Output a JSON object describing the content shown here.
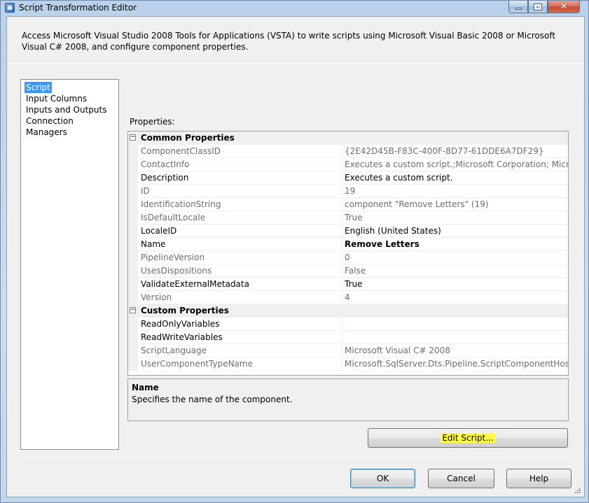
{
  "window": {
    "title": "Script Transformation Editor",
    "minimize_icon": "minimize-icon",
    "maximize_icon": "maximize-icon",
    "close_icon": "close-icon"
  },
  "description": "Access Microsoft Visual Studio 2008 Tools for Applications (VSTA) to write scripts using Microsoft Visual Basic 2008 or Microsoft Visual C# 2008, and configure component properties.",
  "nav": {
    "items": [
      {
        "label": "Script",
        "selected": true
      },
      {
        "label": "Input Columns",
        "selected": false
      },
      {
        "label": "Inputs and Outputs",
        "selected": false
      },
      {
        "label": "Connection Managers",
        "selected": false
      }
    ]
  },
  "properties": {
    "label": "Properties:",
    "common": {
      "label": "Common Properties",
      "toggle": "⊟",
      "rows": [
        {
          "name": "ComponentClassID",
          "value": "{2E42D45B-F83C-400F-8D77-61DDE6A7DF29}",
          "readonly": true
        },
        {
          "name": "ContactInfo",
          "value": "Executes a custom script.;Microsoft Corporation; Microsoft S",
          "readonly": true
        },
        {
          "name": "Description",
          "value": "Executes a custom script.",
          "readonly": false
        },
        {
          "name": "ID",
          "value": "19",
          "readonly": true
        },
        {
          "name": "IdentificationString",
          "value": "component \"Remove Letters\" (19)",
          "readonly": true
        },
        {
          "name": "IsDefaultLocale",
          "value": "True",
          "readonly": true
        },
        {
          "name": "LocaleID",
          "value": "English (United States)",
          "readonly": false
        },
        {
          "name": "Name",
          "value": "Remove Letters",
          "readonly": false,
          "bold": true
        },
        {
          "name": "PipelineVersion",
          "value": "0",
          "readonly": true
        },
        {
          "name": "UsesDispositions",
          "value": "False",
          "readonly": true
        },
        {
          "name": "ValidateExternalMetadata",
          "value": "True",
          "readonly": false
        },
        {
          "name": "Version",
          "value": "4",
          "readonly": true
        }
      ]
    },
    "custom": {
      "label": "Custom Properties",
      "toggle": "⊟",
      "rows": [
        {
          "name": "ReadOnlyVariables",
          "value": "",
          "readonly": false
        },
        {
          "name": "ReadWriteVariables",
          "value": "",
          "readonly": false
        },
        {
          "name": "ScriptLanguage",
          "value": "Microsoft Visual C# 2008",
          "readonly": true
        },
        {
          "name": "UserComponentTypeName",
          "value": "Microsoft.SqlServer.Dts.Pipeline.ScriptComponentHost, Micr",
          "readonly": true
        }
      ]
    }
  },
  "help": {
    "title": "Name",
    "text": "Specifies the name of the component."
  },
  "buttons": {
    "edit_script": "Edit Script...",
    "ok": "OK",
    "cancel": "Cancel",
    "help": "Help"
  },
  "colors": {
    "selection": "#3399ff",
    "highlight": "#ffff40"
  }
}
